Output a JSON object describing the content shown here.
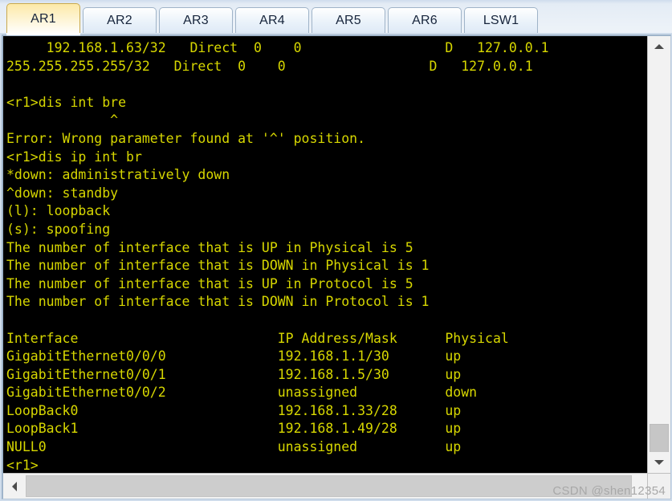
{
  "window": {
    "title": "AR1"
  },
  "tabs": [
    {
      "label": "AR1",
      "active": true
    },
    {
      "label": "AR2",
      "active": false
    },
    {
      "label": "AR3",
      "active": false
    },
    {
      "label": "AR4",
      "active": false
    },
    {
      "label": "AR5",
      "active": false
    },
    {
      "label": "AR6",
      "active": false
    },
    {
      "label": "LSW1",
      "active": false
    }
  ],
  "terminal": {
    "foreground_color": "#d7d700",
    "background_color": "#000000",
    "prompt": "<r1>",
    "lines": [
      "     192.168.1.63/32   Direct  0    0                  D   127.0.0.1",
      "255.255.255.255/32   Direct  0    0                  D   127.0.0.1",
      "",
      "<r1>dis int bre",
      "             ^",
      "Error: Wrong parameter found at '^' position.",
      "<r1>dis ip int br",
      "*down: administratively down",
      "^down: standby",
      "(l): loopback",
      "(s): spoofing",
      "The number of interface that is UP in Physical is 5",
      "The number of interface that is DOWN in Physical is 1",
      "The number of interface that is UP in Protocol is 5",
      "The number of interface that is DOWN in Protocol is 1",
      "",
      "Interface                         IP Address/Mask      Physical",
      "GigabitEthernet0/0/0              192.168.1.1/30       up",
      "GigabitEthernet0/0/1              192.168.1.5/30       up",
      "GigabitEthernet0/0/2              unassigned           down",
      "LoopBack0                         192.168.1.33/28      up",
      "LoopBack1                         192.168.1.49/28      up",
      "NULL0                             unassigned           up",
      "<r1>"
    ],
    "routing_rows": [
      {
        "destination": "192.168.1.63/32",
        "proto": "Direct",
        "pre": "0",
        "cost": "0",
        "flags": "D",
        "nexthop": "127.0.0.1"
      },
      {
        "destination": "255.255.255.255/32",
        "proto": "Direct",
        "pre": "0",
        "cost": "0",
        "flags": "D",
        "nexthop": "127.0.0.1"
      }
    ],
    "commands": [
      {
        "prompt": "<r1>",
        "text": "dis int bre",
        "error": "Error: Wrong parameter found at '^' position."
      },
      {
        "prompt": "<r1>",
        "text": "dis ip int br",
        "error": ""
      }
    ],
    "legend": [
      "*down: administratively down",
      "^down: standby",
      "(l): loopback",
      "(s): spoofing"
    ],
    "counters": [
      "The number of interface that is UP in Physical is 5",
      "The number of interface that is DOWN in Physical is 1",
      "The number of interface that is UP in Protocol is 5",
      "The number of interface that is DOWN in Protocol is 1"
    ],
    "interface_table": {
      "headers": [
        "Interface",
        "IP Address/Mask",
        "Physical"
      ],
      "rows": [
        [
          "GigabitEthernet0/0/0",
          "192.168.1.1/30",
          "up"
        ],
        [
          "GigabitEthernet0/0/1",
          "192.168.1.5/30",
          "up"
        ],
        [
          "GigabitEthernet0/0/2",
          "unassigned",
          "down"
        ],
        [
          "LoopBack0",
          "192.168.1.33/28",
          "up"
        ],
        [
          "LoopBack1",
          "192.168.1.49/28",
          "up"
        ],
        [
          "NULL0",
          "unassigned",
          "up"
        ]
      ]
    }
  },
  "scrollbars": {
    "vertical": {
      "up_icon": "chevron-up-icon",
      "down_icon": "chevron-down-icon"
    },
    "horizontal": {
      "left_icon": "chevron-left-icon"
    }
  },
  "watermark": {
    "text": "CSDN @shen12354"
  }
}
